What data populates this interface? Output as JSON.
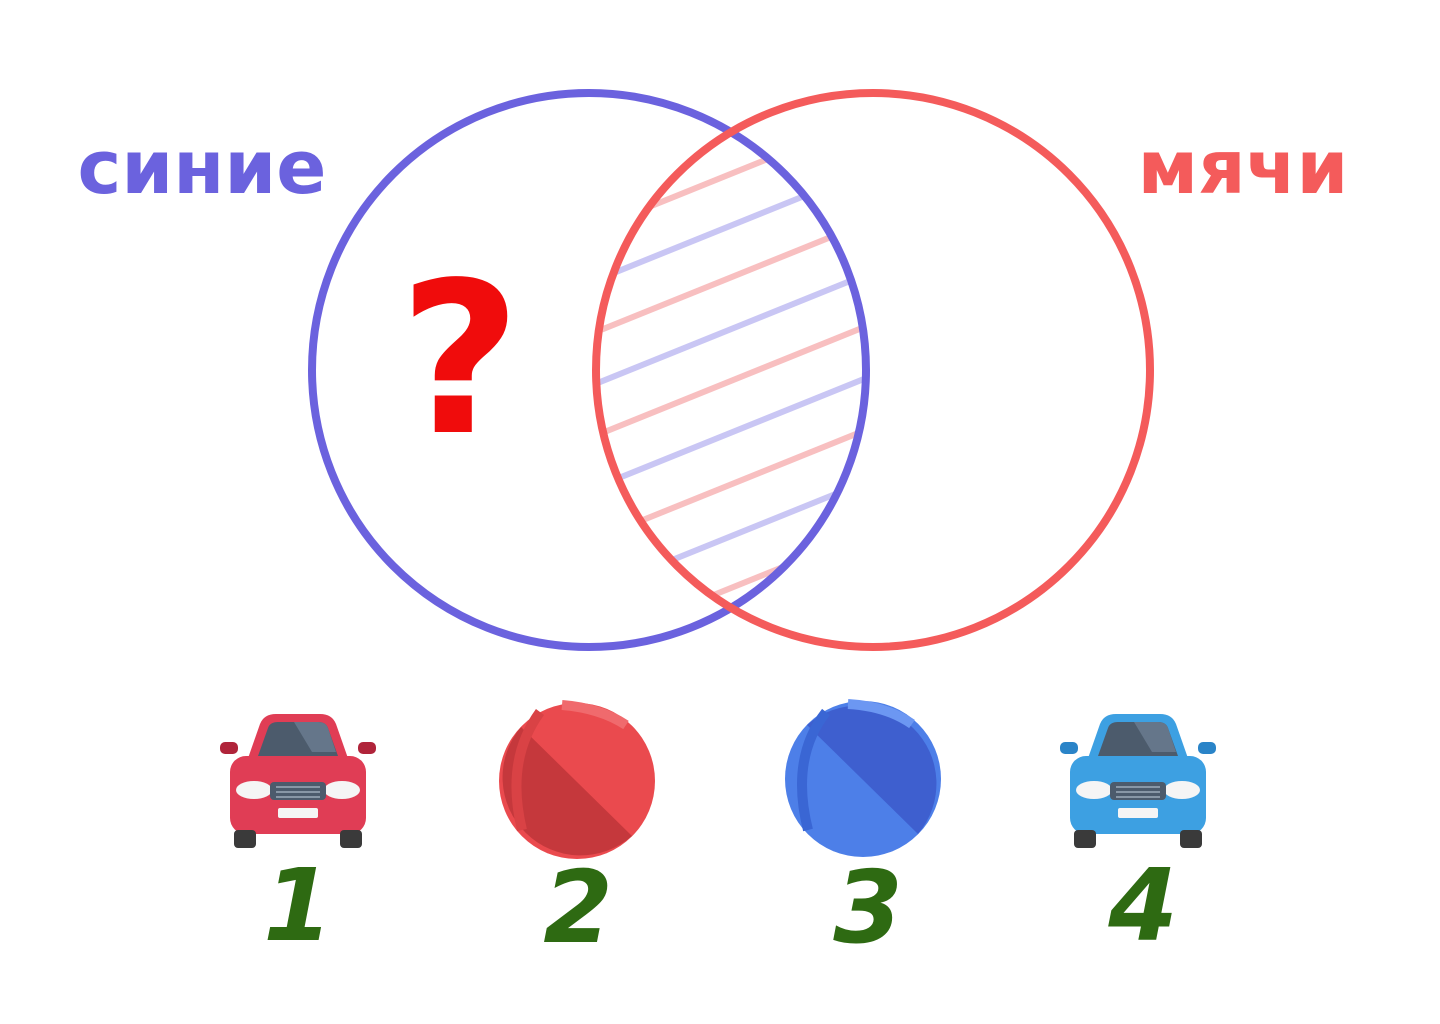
{
  "sets": [
    {
      "label": "синие",
      "color": "#6B62DE"
    },
    {
      "label": "мячи",
      "color": "#F45B5B"
    }
  ],
  "question": "?",
  "question_color": "#F00C0C",
  "number_color": "#2E6A12",
  "items": [
    {
      "number": "1",
      "kind": "car",
      "color": "red",
      "icon": "red-car-icon"
    },
    {
      "number": "2",
      "kind": "ball",
      "color": "red",
      "icon": "red-ball-icon"
    },
    {
      "number": "3",
      "kind": "ball",
      "color": "blue",
      "icon": "blue-ball-icon"
    },
    {
      "number": "4",
      "kind": "car",
      "color": "blue",
      "icon": "blue-car-icon"
    }
  ]
}
